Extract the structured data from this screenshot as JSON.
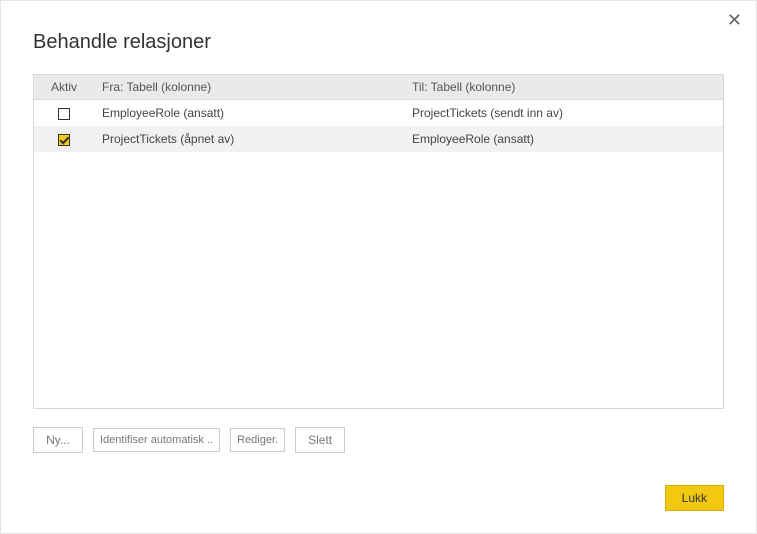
{
  "dialog": {
    "title": "Behandle relasjoner"
  },
  "table": {
    "headers": {
      "active": "Aktiv",
      "from": "Fra: Tabell (kolonne)",
      "to": "Til: Tabell (kolonne)"
    },
    "rows": [
      {
        "active": false,
        "from": "EmployeeRole (ansatt)",
        "to": "ProjectTickets (sendt inn av)"
      },
      {
        "active": true,
        "from": "ProjectTickets (åpnet av)",
        "to": "EmployeeRole (ansatt)"
      }
    ]
  },
  "buttons": {
    "new": "Ny...",
    "autodetect": "Identifiser automatisk ..",
    "edit": "Rediger.",
    "delete": "Slett",
    "close": "Lukk"
  }
}
